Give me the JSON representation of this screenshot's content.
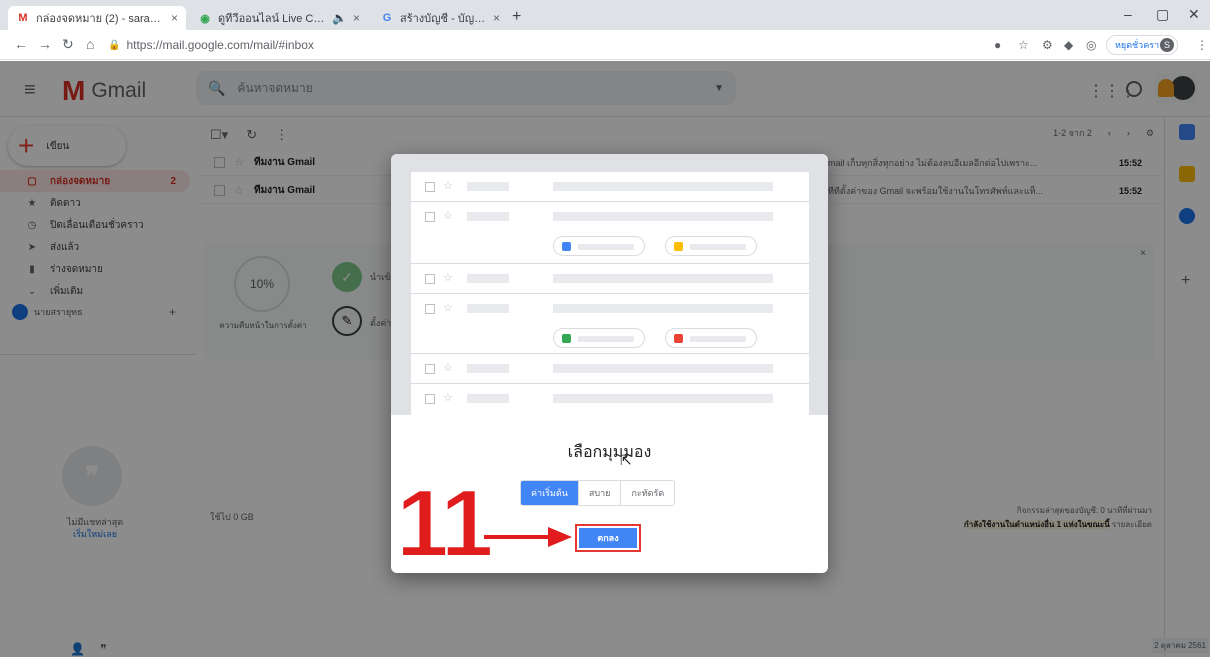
{
  "browser": {
    "tabs": [
      {
        "title": "กล่องจดหมาย (2) - sarayut.k@kor",
        "favicon": "M"
      },
      {
        "title": "ดูทีวีออนไลน์ Live CH65: TrueS",
        "favicon": "◉"
      },
      {
        "title": "สร้างบัญชี - บัญชี Google",
        "favicon": "G"
      }
    ],
    "new_tab": "+",
    "url": "https://mail.google.com/mail/#inbox",
    "profile_label": "หยุดชั่วคราว",
    "profile_initial": "S"
  },
  "gmail": {
    "logo_text": "Gmail",
    "search_placeholder": "ค้นหาจดหมาย",
    "compose_label": "เขียน",
    "nav": [
      {
        "label": "กล่องจดหมาย",
        "count": "2",
        "icon": "inbox-icon"
      },
      {
        "label": "ติดดาว",
        "icon": "star-icon"
      },
      {
        "label": "ปิดเลื่อนเตือนชั่วคราว",
        "icon": "clock-icon"
      },
      {
        "label": "ส่งแล้ว",
        "icon": "send-icon"
      },
      {
        "label": "ร่างจดหมาย",
        "icon": "draft-icon"
      },
      {
        "label": "เพิ่มเติม",
        "icon": "chevron-down-icon"
      }
    ],
    "hangouts_user": "นายสรายุทธ",
    "hangouts_empty": "ไม่มีแชทล่าสุด",
    "hangouts_link": "เริ่มใหม่เลย",
    "pager": "1-2 จาก 2",
    "emails": [
      {
        "sender": "ทีมงาน Gmail",
        "snippet": "mail เก็บทุกสิ่งทุกอย่าง ไม่ต้องลบอีเมลอีกต่อไปเพราะ...",
        "time": "15:52"
      },
      {
        "sender": "ทีมงาน Gmail",
        "snippet": "ทีทีตั้งค่าของ Gmail จะพร้อมใช้งานในโทรศัพท์และแท็...",
        "time": "15:52"
      }
    ],
    "setup": {
      "progress": "10%",
      "progress_label": "ความคืบหน้าในการตั้งค่า",
      "task1": "นำเข้า",
      "task2": "ตั้งค่า"
    },
    "usage": "ใช้ไป 0 GB",
    "activity_line1": "กิจกรรมล่าสุดของบัญชี: 0 นาทีที่ผ่านมา",
    "activity_bold": "กำลังใช้งานในตำแหน่งอื่น 1 แห่งในขณะนี้",
    "activity_details": "รายละเอียด",
    "date_clip": "2 ตุลาคม 2561"
  },
  "modal": {
    "title": "เลือกมุมมอง",
    "options": [
      "ค่าเริ่มต้น",
      "สบาย",
      "กะทัดรัด"
    ],
    "selected": "ค่าเริ่มต้น",
    "ok_label": "ตกลง"
  },
  "annotation": {
    "step": "11",
    "color": "#e01c1c"
  },
  "colors": {
    "gmail_red": "#d93025",
    "accent_blue": "#4285f4"
  }
}
